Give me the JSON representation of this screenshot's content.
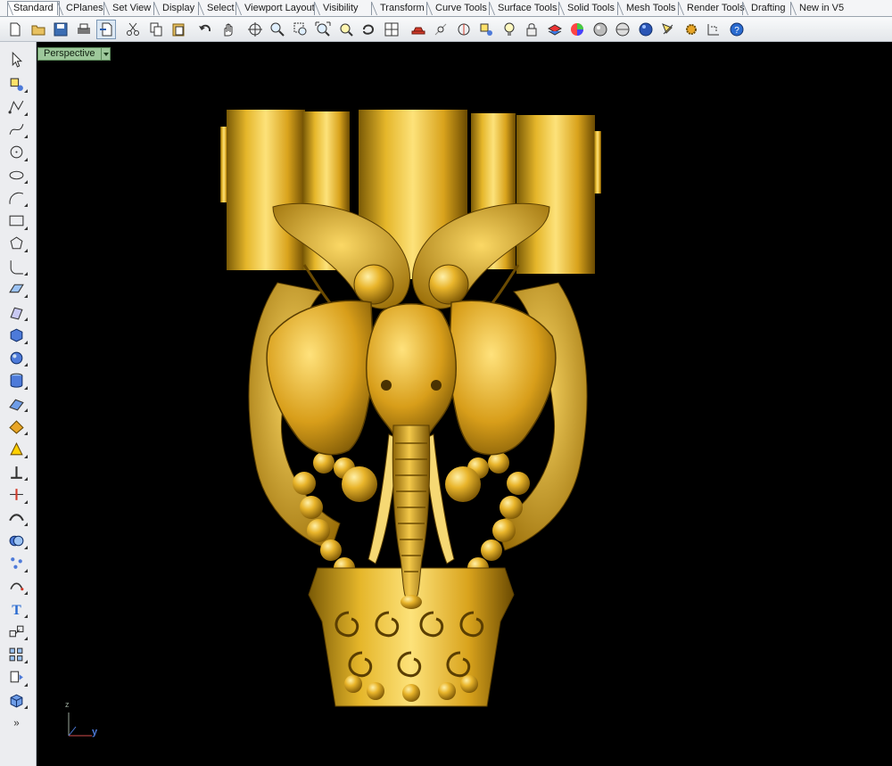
{
  "tabs": [
    {
      "label": "Standard",
      "active": true
    },
    {
      "label": "CPlanes"
    },
    {
      "label": "Set View"
    },
    {
      "label": "Display"
    },
    {
      "label": "Select"
    },
    {
      "label": "Viewport Layout"
    },
    {
      "label": "Visibility"
    },
    {
      "label": "Transform"
    },
    {
      "label": "Curve Tools"
    },
    {
      "label": "Surface Tools"
    },
    {
      "label": "Solid Tools"
    },
    {
      "label": "Mesh Tools"
    },
    {
      "label": "Render Tools"
    },
    {
      "label": "Drafting"
    },
    {
      "label": "New in V5"
    }
  ],
  "toolbar_icons": [
    "new-document-icon",
    "open-folder-icon",
    "save-icon",
    "print-icon",
    "import-icon",
    "cut-icon",
    "copy-icon",
    "paste-icon",
    "undo-icon",
    "pan-hand-icon",
    "rotate-view-icon",
    "zoom-icon",
    "zoom-window-icon",
    "zoom-extents-icon",
    "zoom-selected-icon",
    "undo-view-icon",
    "four-viewports-icon",
    "car-icon",
    "grid-snap-icon",
    "curve-snap-icon",
    "point-icon",
    "light-bulb-icon",
    "lock-icon",
    "layer-icon",
    "color-wheel-icon",
    "render-sphere-icon",
    "material-sphere-icon",
    "blue-sphere-icon",
    "spotlight-icon",
    "options-gear-icon",
    "dimension-icon",
    "help-icon"
  ],
  "left_tools": [
    "select-arrow-icon",
    "point-icon",
    "polyline-icon",
    "curve-icon",
    "circle-icon",
    "ellipse-icon",
    "arc-icon",
    "rectangle-icon",
    "polygon-icon",
    "fillet-icon",
    "surface-icon",
    "extrude-icon",
    "box-icon",
    "sphere-icon",
    "cylinder-icon",
    "plane-surface-icon",
    "surface-tools-icon",
    "light-icon",
    "text-dot-icon",
    "split-icon",
    "join-icon",
    "boolean-icon",
    "point-cloud-icon",
    "curve-from-object-icon",
    "text-icon",
    "block-icon",
    "array-icon",
    "explode-icon",
    "solid-box-icon",
    "more-chevron-icon"
  ],
  "viewport": {
    "title": "Perspective",
    "axes": {
      "y": "y",
      "z": "z"
    }
  },
  "colors": {
    "viewport_bg": "#000000",
    "model_gold": "#e8b52a",
    "title_bg": "#9dc89b"
  }
}
